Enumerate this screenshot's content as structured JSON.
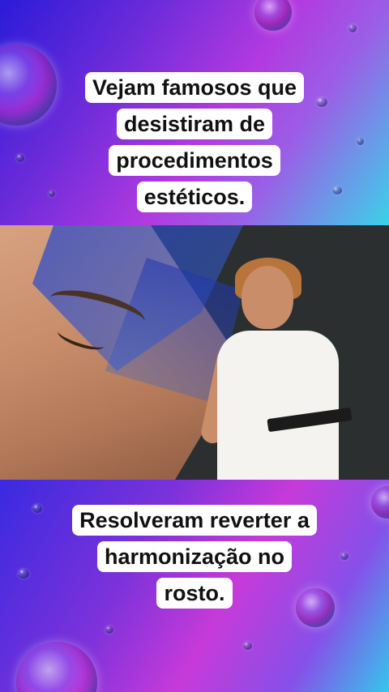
{
  "top_caption": {
    "lines": [
      "Vejam famosos que",
      "desistiram de",
      "procedimentos",
      "estéticos."
    ]
  },
  "bottom_caption": {
    "lines": [
      "Resolveram reverter a",
      "harmonização no",
      "rosto."
    ]
  },
  "colors": {
    "caption_bg": "#ffffff",
    "caption_text": "#111111",
    "bg_purple": "#7c32da",
    "bg_cyan": "#35c6ec",
    "video_bg": "#2b2f2f"
  }
}
